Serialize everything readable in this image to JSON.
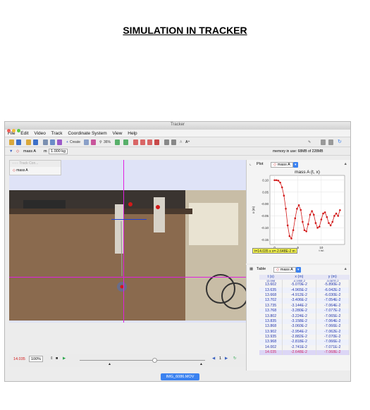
{
  "page": {
    "title": "SIMULATION IN TRACKER"
  },
  "window": {
    "title": "Tracker"
  },
  "menu": [
    "File",
    "Edit",
    "Video",
    "Track",
    "Coordinate System",
    "View",
    "Help"
  ],
  "toolbar": {
    "create_label": "Create",
    "zoom_label": "36%"
  },
  "trackbar": {
    "track_name": "mass A",
    "mass_label": "m",
    "mass_value": "1.000 kg",
    "memory_text": "memory in use: 68MB of 228MB"
  },
  "track_control": {
    "title": "Track Con...",
    "item": "mass A"
  },
  "plot": {
    "tab_label": "Plot",
    "track": "mass A",
    "readout": "t=14.035 s  x=-2.648E-2 m"
  },
  "table": {
    "tab_label": "Table",
    "track": "mass A",
    "headers": [
      "t (s)",
      "x (m)",
      "y (m)"
    ],
    "partial_row": [
      "13.598",
      "-4.195E-2",
      "-5.087E-2"
    ],
    "rows": [
      [
        "13.602",
        "-5.070E-2",
        "-5.890E-2"
      ],
      [
        "13.635",
        "-4.965E-2",
        "-6.042E-2"
      ],
      [
        "13.668",
        "-4.912E-2",
        "-6.030E-2"
      ],
      [
        "13.702",
        "-3.406E-2",
        "-7.054E-2"
      ],
      [
        "13.735",
        "-3.144E-2",
        "-7.064E-2"
      ],
      [
        "13.768",
        "-3.280E-2",
        "-7.077E-2"
      ],
      [
        "13.802",
        "-3.224E-2",
        "-7.065E-2"
      ],
      [
        "13.835",
        "-3.158E-2",
        "-7.064E-2"
      ],
      [
        "13.868",
        "-3.060E-2",
        "-7.066E-2"
      ],
      [
        "13.902",
        "-2.954E-2",
        "-7.062E-2"
      ],
      [
        "13.935",
        "-2.882E-2",
        "-7.070E-2"
      ],
      [
        "13.968",
        "-2.818E-2",
        "-7.066E-2"
      ],
      [
        "14.002",
        "-2.741E-2",
        "-7.071E-2"
      ],
      [
        "14.035",
        "-2.648E-2",
        "-7.068E-2"
      ]
    ]
  },
  "player": {
    "time": "14.035",
    "rate": "100%",
    "step": "1"
  },
  "file_tab": "IMG_6086.MOV",
  "chart_data": {
    "type": "scatter",
    "title": "mass A (t, x)",
    "xlabel": "t (s)",
    "ylabel": "x (m)",
    "xlim": [
      -1,
      15
    ],
    "ylim": [
      -0.17,
      0.12
    ],
    "xticks": [
      0,
      5,
      10
    ],
    "yticks": [
      0.1,
      0.05,
      -0.0,
      -0.05,
      -0.1,
      -0.15
    ],
    "ytick_labels": [
      "0.10",
      "0.05",
      "-0.00",
      "-0.05",
      "-0.10",
      "-0.15"
    ],
    "series": [
      {
        "color": "#d21a1a",
        "x": [
          0.0,
          0.4,
          0.8,
          1.2,
          1.6,
          2.0,
          2.4,
          2.8,
          3.2,
          3.6,
          4.0,
          4.4,
          4.8,
          5.2,
          5.6,
          6.0,
          6.4,
          6.8,
          7.2,
          7.6,
          8.0,
          8.4,
          8.8,
          9.2,
          9.6,
          10.0,
          10.4,
          10.8,
          11.2,
          11.6,
          12.0,
          12.4,
          12.8,
          13.2,
          13.6,
          14.0
        ],
        "y": [
          0.1,
          0.1,
          0.098,
          0.09,
          0.07,
          0.035,
          -0.02,
          -0.09,
          -0.135,
          -0.145,
          -0.11,
          -0.06,
          -0.02,
          -0.005,
          -0.025,
          -0.075,
          -0.11,
          -0.115,
          -0.085,
          -0.045,
          -0.03,
          -0.045,
          -0.08,
          -0.1,
          -0.095,
          -0.065,
          -0.04,
          -0.035,
          -0.055,
          -0.08,
          -0.09,
          -0.075,
          -0.05,
          -0.04,
          -0.05,
          -0.026
        ]
      }
    ]
  },
  "colors": {
    "accent": "#3b82f0",
    "marker": "#d21a1a",
    "crosshair": "#e020e0",
    "readout_bg": "#f2f24a"
  }
}
